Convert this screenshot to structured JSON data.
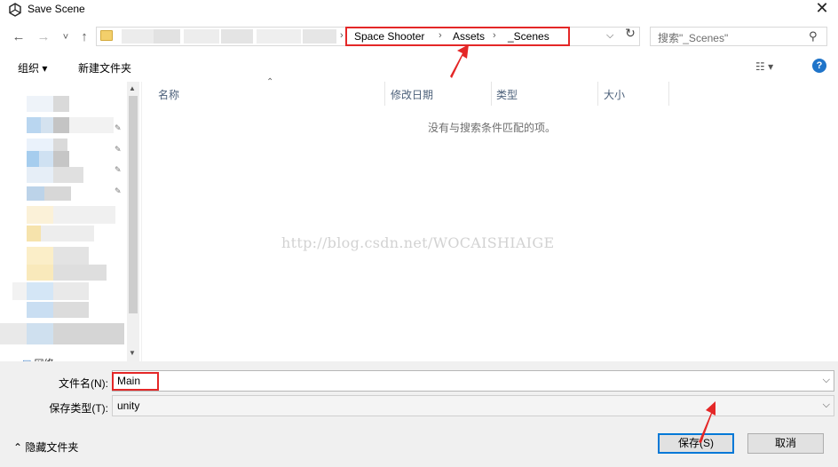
{
  "window": {
    "title": "Save Scene",
    "close_glyph": "✕"
  },
  "nav": {
    "back_glyph": "←",
    "forward_glyph": "→",
    "recent_glyph": "˅",
    "up_glyph": "↑",
    "sep": "›",
    "breadcrumbs": [
      "Space Shooter",
      "Assets",
      "_Scenes"
    ],
    "dropdown_glyph": "⌵",
    "refresh_glyph": "↻"
  },
  "search": {
    "placeholder": "搜索\"_Scenes\"",
    "icon": "search-icon",
    "glyph": "⚲"
  },
  "toolbar": {
    "organize": "组织 ▾",
    "new_folder": "新建文件夹",
    "view_glyph": "☷ ▾",
    "help": "?"
  },
  "columns": [
    "名称",
    "修改日期",
    "类型",
    "大小"
  ],
  "empty_message": "没有与搜索条件匹配的项。",
  "watermark": "http://blog.csdn.net/WOCAISHIAIGE",
  "sidebar": {
    "network_label": "网络"
  },
  "form": {
    "filename_label": "文件名(N):",
    "filename_value": "Main",
    "filetype_label": "保存类型(T):",
    "filetype_value": "unity"
  },
  "footer": {
    "hide_folders": "隐藏文件夹",
    "hide_glyph": "⌃",
    "save_button": "保存(S)",
    "cancel_button": "取消"
  },
  "colors": {
    "highlight": "#e42727",
    "accent": "#0078d7",
    "help": "#1f74c9"
  }
}
